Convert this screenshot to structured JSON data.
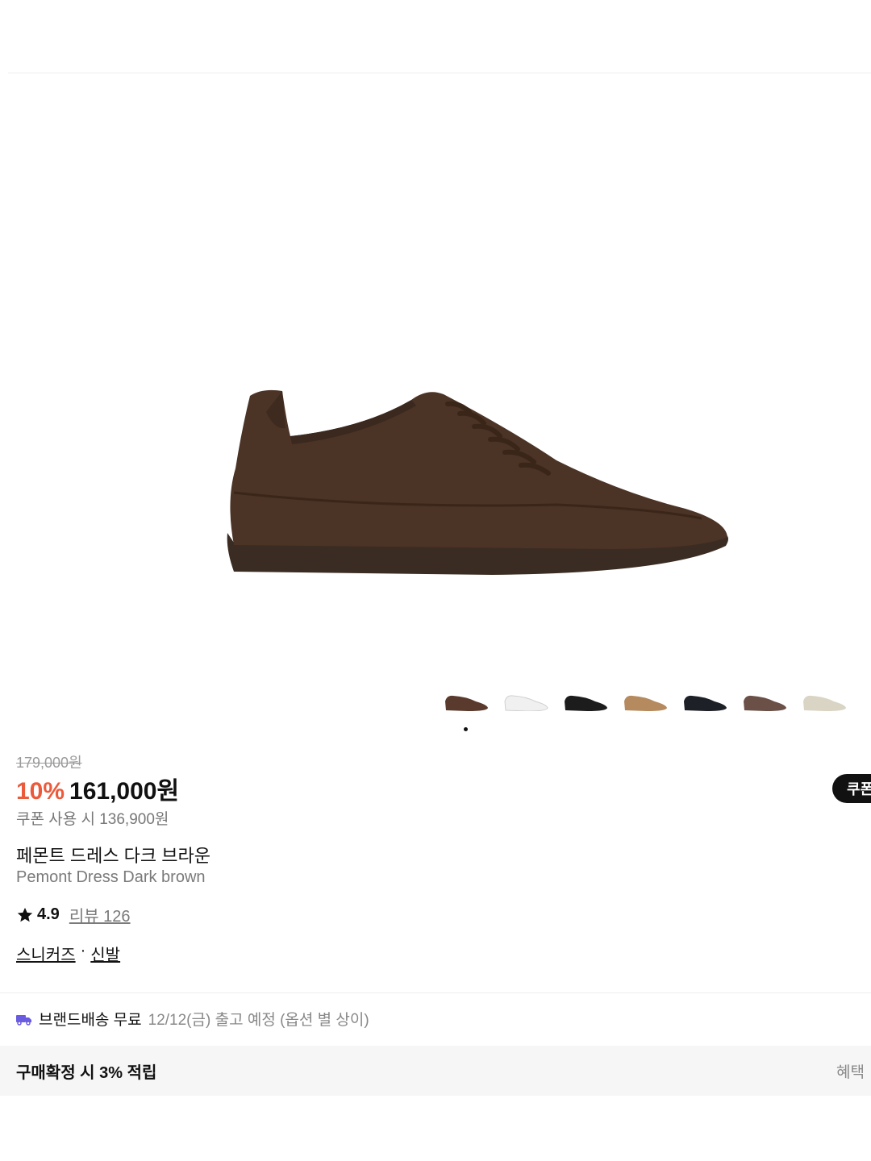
{
  "product": {
    "original_price": "179,000원",
    "discount": "10%",
    "sale_price": "161,000원",
    "coupon_price": "쿠폰 사용 시 136,900원",
    "coupon_button": "쿠폰",
    "title_ko": "페몬트 드레스 다크 브라운",
    "title_en": "Pemont Dress Dark brown",
    "rating": "4.9",
    "review": "리뷰 126",
    "categories": [
      "스니커즈",
      "신발"
    ],
    "category_separator": "·"
  },
  "gallery": {
    "main_image": "dark-brown-suede-sneaker",
    "thumbnails": [
      {
        "color": "#5a3a2c"
      },
      {
        "color": "#f0f0f0"
      },
      {
        "color": "#1c1c1c"
      },
      {
        "color": "#b58a5e"
      },
      {
        "color": "#1d2027"
      },
      {
        "color": "#6a5046"
      },
      {
        "color": "#d9d4c4"
      }
    ]
  },
  "shipping": {
    "label": "브랜드배송 무료",
    "eta": "12/12(금) 출고 예정 (옵션 별 상이)"
  },
  "benefit": {
    "text": "구매확정 시 3% 적립",
    "link": "혜택"
  },
  "icons": {
    "star": "star-icon",
    "truck": "truck-icon"
  },
  "colors": {
    "discount": "#ec5a3c",
    "truck_icon": "#6a5ce0"
  }
}
